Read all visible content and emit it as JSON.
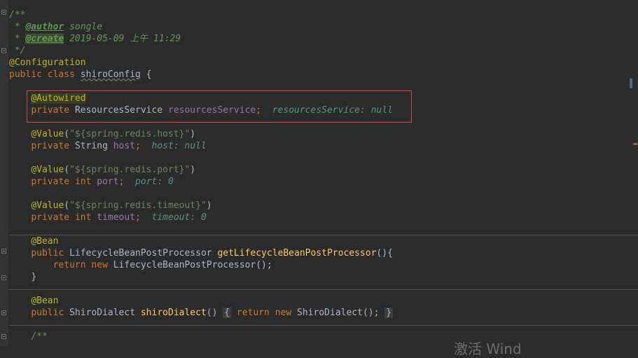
{
  "doc_comment": {
    "open": "/**",
    "author_prefix": " * ",
    "author_tag": "@author",
    "author_value": " songle",
    "create_prefix": " * ",
    "create_tag": "@create",
    "create_value": " 2019-05-09 上午 11:29",
    "close": " */"
  },
  "class_annotation": "@Configuration",
  "class_decl": {
    "kw1": "public",
    "kw2": "class",
    "name": "shiroConfig",
    "brace": " {"
  },
  "fields": [
    {
      "ann": "@Autowired",
      "ann_arg": "",
      "kw_private": "private",
      "kw_type": "",
      "type": "ResourcesService",
      "name": "resourcesService",
      "semi": ";",
      "hint": "resourcesService: null"
    },
    {
      "ann": "@Value",
      "ann_arg": "\"${spring.redis.host}\"",
      "kw_private": "private",
      "kw_type": "",
      "type": "String",
      "name": "host",
      "semi": ";",
      "hint": "host: null"
    },
    {
      "ann": "@Value",
      "ann_arg": "\"${spring.redis.port}\"",
      "kw_private": "private",
      "kw_type": "int",
      "type": "",
      "name": "port",
      "semi": ";",
      "hint": "port: 0"
    },
    {
      "ann": "@Value",
      "ann_arg": "\"${spring.redis.timeout}\"",
      "kw_private": "private",
      "kw_type": "int",
      "type": "",
      "name": "timeout",
      "semi": ";",
      "hint": "timeout: 0"
    }
  ],
  "bean1": {
    "ann": "@Bean",
    "kw_public": "public",
    "ret_type": "LifecycleBeanPostProcessor",
    "method": "getLifecycleBeanPostProcessor",
    "sig_tail": "(){",
    "kw_return": "return",
    "kw_new": "new",
    "ret_expr": "LifecycleBeanPostProcessor();",
    "close": "}"
  },
  "bean2": {
    "ann": "@Bean",
    "kw_public": "public",
    "ret_type": "ShiroDialect",
    "method": "shiroDialect",
    "parens": "()",
    "open_brace": "{",
    "kw_return": "return",
    "kw_new": "new",
    "ret_expr": "ShiroDialect();",
    "close_brace": "}"
  },
  "next_doc_open": "/**",
  "watermark": "激活 Wind",
  "colors": {
    "background": "#2b2b2b",
    "keyword": "#cc7832",
    "annotation": "#bbb529",
    "field": "#9876aa",
    "string": "#6a8759",
    "method": "#ffc66d",
    "doc": "#629755",
    "highlight_box": "#e0424a"
  }
}
